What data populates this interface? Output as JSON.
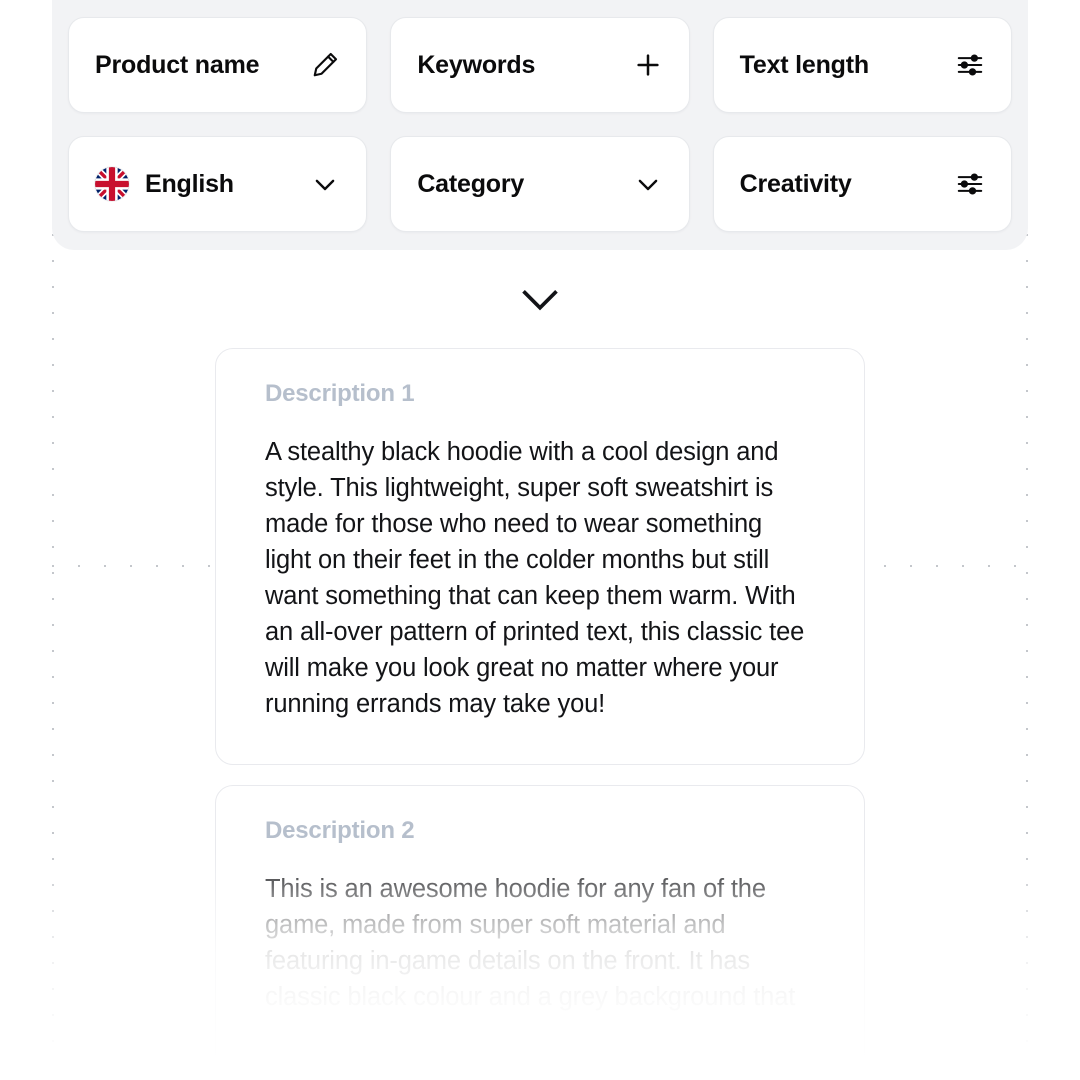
{
  "toolbar": {
    "rows": [
      [
        {
          "label": "Product name",
          "icon": "pencil-icon",
          "name": "product-name-field"
        },
        {
          "label": "Keywords",
          "icon": "plus-icon",
          "name": "keywords-field"
        },
        {
          "label": "Text length",
          "icon": "sliders-icon",
          "name": "text-length-control"
        }
      ],
      [
        {
          "label": "English",
          "icon": "chevron-down-icon",
          "leading_icon": "uk-flag-icon",
          "name": "language-select"
        },
        {
          "label": "Category",
          "icon": "chevron-down-icon",
          "name": "category-select"
        },
        {
          "label": "Creativity",
          "icon": "sliders-icon",
          "name": "creativity-control"
        }
      ]
    ]
  },
  "expand": {
    "icon": "chevron-down-icon"
  },
  "results": {
    "cards": [
      {
        "title": "Description 1",
        "body": "A stealthy black hoodie with a cool design and style. This lightweight, super soft sweatshirt is made for those who need to wear something light on their feet in the colder months but still want something that can keep them warm. With an all-over pattern of printed text, this classic tee will make you look great no matter where your running errands may take you!"
      },
      {
        "title": "Description 2",
        "body": "This is an awesome hoodie for any fan of the game, made from super soft material and featuring in-game details on the front. It has classic black colour and a grey background that"
      }
    ]
  },
  "colors": {
    "panel_bg": "#f2f3f5",
    "card_bg": "#ffffff",
    "card_border": "#e7e9ec",
    "label_text": "#0b0b0c",
    "desc_title": "#b6bfcc",
    "desc_body": "#131417",
    "guide_dot": "#c4c7cc"
  }
}
